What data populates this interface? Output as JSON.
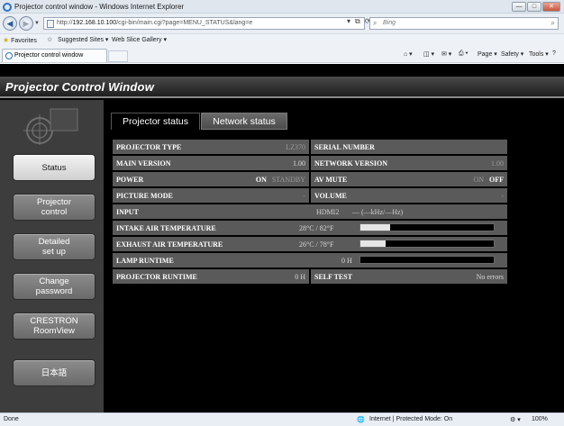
{
  "browser": {
    "window_title": "Projector control window - Windows Internet Explorer",
    "url_prefix": "http://",
    "url_host": "192.168.10.100",
    "url_path": "/cgi-bin/main.cgi?page=MENU_STATUS&lang=e",
    "search_placeholder": "Bing",
    "favorites_label": "Favorites",
    "suggested_sites_label": "Suggested Sites ▾",
    "web_slice_label": "Web Slice Gallery ▾",
    "tab_title": "Projector control window",
    "commands": {
      "page": "Page ▾",
      "safety": "Safety ▾",
      "tools": "Tools ▾"
    }
  },
  "app": {
    "title": "Projector Control Window",
    "sidebar": [
      {
        "label": "Status",
        "active": true
      },
      {
        "label": "Projector\ncontrol",
        "active": false
      },
      {
        "label": "Detailed\nset up",
        "active": false
      },
      {
        "label": "Change\npassword",
        "active": false
      },
      {
        "label": "CRESTRON\nRoomView",
        "active": false
      },
      {
        "label": "日本語",
        "active": false
      }
    ],
    "tabs": [
      {
        "label": "Projector status",
        "active": true
      },
      {
        "label": "Network status",
        "active": false
      }
    ],
    "status": {
      "projector_type_label": "PROJECTOR TYPE",
      "projector_type_value": "LZ370",
      "serial_number_label": "SERIAL NUMBER",
      "serial_number_value": "",
      "main_version_label": "MAIN VERSION",
      "main_version_value": "1.00",
      "network_version_label": "NETWORK VERSION",
      "network_version_value": "1.00",
      "power_label": "POWER",
      "power_on": "ON",
      "power_standby": "STANDBY",
      "av_mute_label": "AV MUTE",
      "av_mute_on": "ON",
      "av_mute_off": "OFF",
      "picture_mode_label": "PICTURE MODE",
      "picture_mode_value": "-",
      "volume_label": "VOLUME",
      "volume_value": "-",
      "input_label": "INPUT",
      "input_value": "HDMI2",
      "input_signal": "— (—kHz/—Hz)",
      "intake_label": "INTAKE AIR TEMPERATURE",
      "intake_value": "28°C / 82°F",
      "intake_level": 0.22,
      "exhaust_label": "EXHAUST AIR TEMPERATURE",
      "exhaust_value": "26°C / 78°F",
      "exhaust_level": 0.19,
      "lamp_label": "LAMP RUNTIME",
      "lamp_value": "0 H",
      "lamp_level": 0,
      "runtime_label": "PROJECTOR RUNTIME",
      "runtime_value": "0 H",
      "self_test_label": "SELF TEST",
      "self_test_value": "No errors"
    }
  },
  "statusbar": {
    "left": "Done",
    "zone": "Internet | Protected Mode: On",
    "zoom": "100%"
  }
}
